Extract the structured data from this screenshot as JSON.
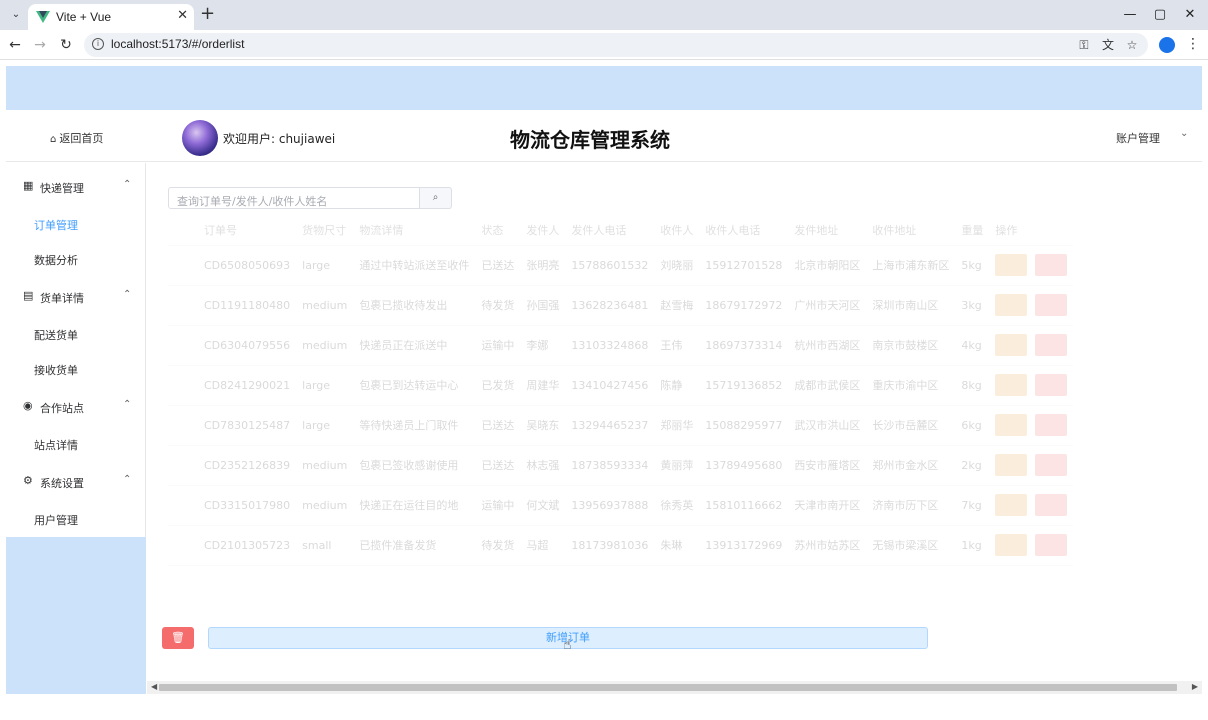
{
  "browser": {
    "tab_title": "Vite + Vue",
    "tab_close": "✕",
    "new_tab": "+",
    "url": "localhost:5173/#/orderlist",
    "window_buttons": [
      "—",
      "▢",
      "✕"
    ]
  },
  "header": {
    "home_label": "返回首页",
    "welcome": "欢迎用户: chujiawei",
    "title": "物流仓库管理系统",
    "account_label": "账户管理"
  },
  "sidebar": {
    "groups": [
      {
        "label": "快递管理",
        "icon": "grid-icon",
        "items": [
          "订单管理",
          "数据分析"
        ]
      },
      {
        "label": "货单详情",
        "icon": "document-icon",
        "items": [
          "配送货单",
          "接收货单"
        ]
      },
      {
        "label": "合作站点",
        "icon": "location-icon",
        "items": [
          "站点详情"
        ]
      },
      {
        "label": "系统设置",
        "icon": "gear-icon",
        "items": [
          "用户管理"
        ]
      }
    ],
    "active_item": "订单管理"
  },
  "search": {
    "placeholder": "查询订单号/发件人/收件人姓名"
  },
  "table": {
    "columns": [
      "订单号",
      "货物尺寸",
      "物流详情",
      "状态",
      "发件人",
      "发件人电话",
      "收件人",
      "收件人电话",
      "发件地址",
      "收件地址",
      "重量",
      "操作"
    ],
    "rows": [
      [
        "CD6508050693",
        "large",
        "通过中转站派送至收件",
        "已送达",
        "张明亮",
        "15788601532",
        "刘晓丽",
        "15912701528",
        "北京市朝阳区",
        "上海市浦东新区",
        "5kg"
      ],
      [
        "CD1191180480",
        "medium",
        "包裹已揽收待发出",
        "待发货",
        "孙国强",
        "13628236481",
        "赵雪梅",
        "18679172972",
        "广州市天河区",
        "深圳市南山区",
        "3kg"
      ],
      [
        "CD6304079556",
        "medium",
        "快递员正在派送中",
        "运输中",
        "李娜",
        "13103324868",
        "王伟",
        "18697373314",
        "杭州市西湖区",
        "南京市鼓楼区",
        "4kg"
      ],
      [
        "CD8241290021",
        "large",
        "包裹已到达转运中心",
        "已发货",
        "周建华",
        "13410427456",
        "陈静",
        "15719136852",
        "成都市武侯区",
        "重庆市渝中区",
        "8kg"
      ],
      [
        "CD7830125487",
        "large",
        "等待快递员上门取件",
        "已送达",
        "吴晓东",
        "13294465237",
        "郑丽华",
        "15088295977",
        "武汉市洪山区",
        "长沙市岳麓区",
        "6kg"
      ],
      [
        "CD2352126839",
        "medium",
        "包裹已签收感谢使用",
        "已送达",
        "林志强",
        "18738593334",
        "黄丽萍",
        "13789495680",
        "西安市雁塔区",
        "郑州市金水区",
        "2kg"
      ],
      [
        "CD3315017980",
        "medium",
        "快递正在运往目的地",
        "运输中",
        "何文斌",
        "13956937888",
        "徐秀英",
        "15810116662",
        "天津市南开区",
        "济南市历下区",
        "7kg"
      ],
      [
        "CD2101305723",
        "small",
        "已揽件准备发货",
        "待发货",
        "马超",
        "18173981036",
        "朱琳",
        "13913172969",
        "苏州市姑苏区",
        "无锡市梁溪区",
        "1kg"
      ]
    ]
  },
  "actions": {
    "delete_icon": "🗑",
    "add_label": "新增订单"
  },
  "colors": {
    "primary": "#409eff",
    "danger": "#f56c6c",
    "warning": "#e6a23c",
    "banner": "#cce2fb"
  }
}
